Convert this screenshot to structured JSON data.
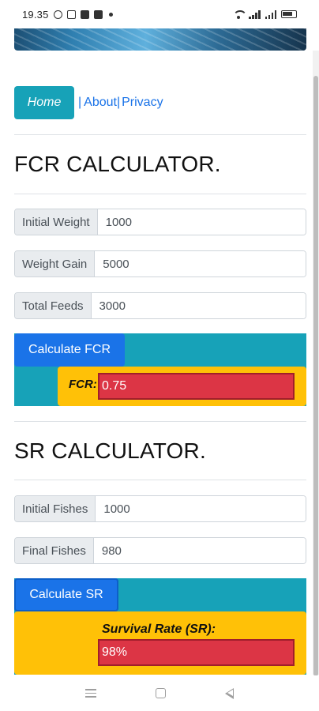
{
  "status_bar": {
    "time": "19.35",
    "icons": [
      "whatsapp-icon",
      "instagram-icon",
      "app-icon",
      "media-icon",
      "notification-dot-icon",
      "wifi-icon",
      "signal-icon",
      "signal-icon",
      "battery-icon"
    ]
  },
  "nav": {
    "home_label": "Home",
    "separator": "|",
    "about_label": "About",
    "privacy_label": "Privacy"
  },
  "fcr": {
    "title": "FCR CALCULATOR.",
    "fields": [
      {
        "label": "Initial Weight",
        "value": "1000"
      },
      {
        "label": "Weight Gain",
        "value": "5000"
      },
      {
        "label": "Total Feeds",
        "value": "3000"
      }
    ],
    "button_label": "Calculate FCR",
    "result_label": "FCR:",
    "result_value": "0.75"
  },
  "sr": {
    "title": "SR CALCULATOR.",
    "fields": [
      {
        "label": "Initial Fishes",
        "value": "1000"
      },
      {
        "label": "Final Fishes",
        "value": "980"
      }
    ],
    "button_label": "Calculate SR",
    "result_label": "Survival Rate (SR):",
    "result_value": "98%"
  },
  "colors": {
    "info": "#17a2b8",
    "primary": "#1a73e8",
    "warning": "#ffc107",
    "danger": "#dc3545"
  },
  "bottom_nav": [
    "menu-icon",
    "home-square-icon",
    "back-triangle-icon"
  ]
}
